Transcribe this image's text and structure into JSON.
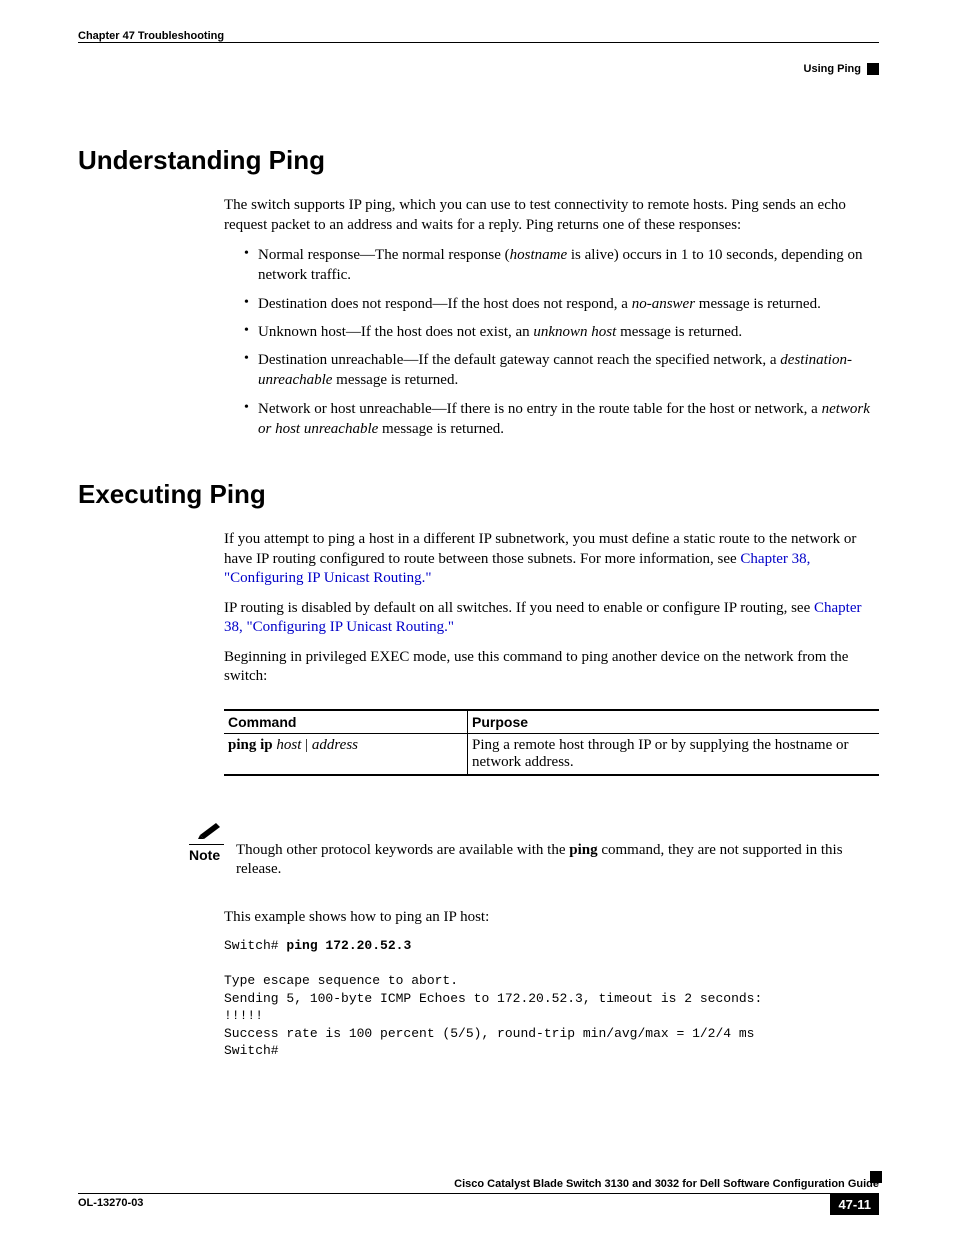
{
  "header": {
    "chapter": "Chapter 47    Troubleshooting",
    "section": "Using Ping"
  },
  "s1": {
    "title": "Understanding Ping",
    "intro": "The switch supports IP ping, which you can use to test connectivity to remote hosts. Ping sends an echo request packet to an address and waits for a reply. Ping returns one of these responses:",
    "b1a": "Normal response—The normal response (",
    "b1b": " is alive) occurs in 1 to 10 seconds, depending on network traffic.",
    "b1_i": "hostname",
    "b2a": "Destination does not respond—If the host does not respond, a ",
    "b2_i": "no-answer",
    "b2b": " message is returned.",
    "b3a": "Unknown host—If the host does not exist, an ",
    "b3_i": "unknown host",
    "b3b": " message is returned.",
    "b4a": "Destination unreachable—If the default gateway cannot reach the specified network, a ",
    "b4_i": "destination-unreachable",
    "b4b": " message is returned.",
    "b5a": "Network or host unreachable—If there is no entry in the route table for the host or network, a ",
    "b5_i": "network or host unreachable",
    "b5b": " message is returned."
  },
  "s2": {
    "title": "Executing Ping",
    "p1a": "If you attempt to ping a host in a different IP subnetwork, you must define a static route to the network or have IP routing configured to route between those subnets. For more information, see ",
    "p1_link": "Chapter 38, \"Configuring IP Unicast Routing.\"",
    "p2a": "IP routing is disabled by default on all switches. If you need to enable or configure IP routing, see ",
    "p2_link": "Chapter 38, \"Configuring IP Unicast Routing.\"",
    "p3": "Beginning in privileged EXEC mode, use this command to ping another device on the network from the switch:",
    "table": {
      "h1": "Command",
      "h2": "Purpose",
      "cmd_b": "ping ip ",
      "cmd_i1": "host",
      "cmd_sep": " | ",
      "cmd_i2": "address",
      "purpose": "Ping a remote host through IP or by supplying the hostname or network address."
    },
    "note_label": "Note",
    "note_a": "Though other protocol keywords are available with the ",
    "note_b": "ping",
    "note_c": " command, they are not supported in this release.",
    "example_intro": "This example shows how to ping an IP host:",
    "code_prompt1": "Switch# ",
    "code_cmd": "ping 172.20.52.3",
    "code_body": "\nType escape sequence to abort.\nSending 5, 100-byte ICMP Echoes to 172.20.52.3, timeout is 2 seconds:\n!!!!!\nSuccess rate is 100 percent (5/5), round-trip min/avg/max = 1/2/4 ms\nSwitch#"
  },
  "footer": {
    "guide": "Cisco Catalyst Blade Switch 3130 and 3032 for Dell Software Configuration Guide",
    "docid": "OL-13270-03",
    "page": "47-11"
  }
}
